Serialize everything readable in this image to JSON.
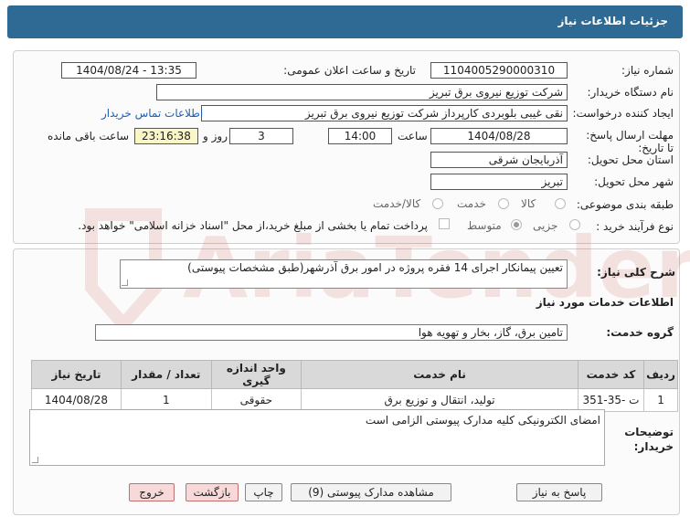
{
  "header": {
    "title": "جزئیات اطلاعات نیاز"
  },
  "form": {
    "need_number_label": "شماره نیاز:",
    "need_number": "1104005290000310",
    "announce_label": "تاریخ و ساعت اعلان عمومی:",
    "announce_value": "1404/08/24 - 13:35",
    "buyer_org_label": "نام دستگاه خریدار:",
    "buyer_org": "شرکت توزیع نیروی برق تبریز",
    "creator_label": "ایجاد کننده درخواست:",
    "creator": "نقی غیبی بلوبردی کارپرداز شرکت توزیع نیروی برق تبریز",
    "contact_link": "اطلاعات تماس خریدار",
    "deadline_label": "مهلت ارسال پاسخ: تا تاریخ:",
    "deadline_date": "1404/08/28",
    "time_label": "ساعت",
    "deadline_time": "14:00",
    "days_value": "3",
    "days_label": "روز و",
    "remaining_time": "23:16:38",
    "remaining_label": "ساعت باقی مانده",
    "province_label": "استان محل تحویل:",
    "province": "آذربایجان شرقی",
    "city_label": "شهر محل تحویل:",
    "city": "تبریز",
    "category_label": "طبقه بندی موضوعی:",
    "category_options": [
      "کالا",
      "خدمت",
      "کالا/خدمت"
    ],
    "process_label": "نوع فرآیند خرید :",
    "process_options": [
      "جزیی",
      "متوسط"
    ],
    "payment_note": "پرداخت تمام یا بخشی از مبلغ خرید،از محل \"اسناد خزانه اسلامی\" خواهد بود."
  },
  "details": {
    "summary_label": "شرح کلی نیاز:",
    "summary": "تعیین پیمانکار اجرای 14 فقره پروژه در امور برق آذرشهر(طبق مشخصات پیوستی)",
    "services_heading": "اطلاعات خدمات مورد نیاز",
    "service_group_label": "گروه خدمت:",
    "service_group": "تامین برق، گاز، بخار و تهویه هوا",
    "table": {
      "headers": [
        "ردیف",
        "کد خدمت",
        "نام خدمت",
        "واحد اندازه گیری",
        "تعداد / مقدار",
        "تاریخ نیاز"
      ],
      "rows": [
        [
          "1",
          "ت -35-351",
          "تولید، انتقال و توزیع برق",
          "حقوقی",
          "1",
          "1404/08/28"
        ]
      ]
    },
    "buyer_notes_label": "توضیحات خریدار:",
    "buyer_notes": "امضای الکترونیکی کلیه مدارک پیوستی الزامی است"
  },
  "buttons": {
    "reply": "پاسخ به نیاز",
    "attachments": "مشاهده مدارک پیوستی (9)",
    "print": "چاپ",
    "back": "بازگشت",
    "exit": "خروج"
  },
  "watermark": {
    "text": "AriaTender.net"
  }
}
